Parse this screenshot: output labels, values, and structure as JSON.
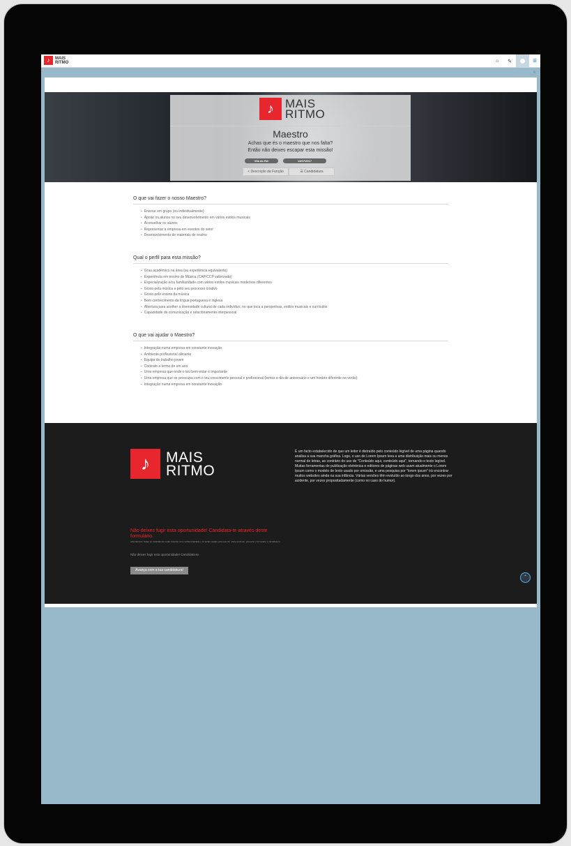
{
  "nav": {
    "logo_line1": "MAIS",
    "logo_line2": "RITMO",
    "logo_glyph": "♪",
    "home_icon": "⌂",
    "edit_icon": "✎",
    "menu_icon": "≡"
  },
  "hero": {
    "logo_line1": "MAIS",
    "logo_line2": "RITMO",
    "logo_glyph": "♪",
    "title": "Maestro",
    "subtitle1": "Achas que és o maestro que nos falta?",
    "subtitle2": "Então não deixes escapar esta missão!",
    "location": "Vila do Rei",
    "date": "14/07/2017",
    "btn_description": "< Descrição da Função",
    "btn_apply": "☰ Candidatura"
  },
  "sections": [
    {
      "title": "O que vai fazer o nosso Maestro?",
      "items": [
        "Ensinar em grupo (ou individualmente)",
        "Apoiar os alunos no seu desenvolvimento em vários estilos musicais",
        "Aconselhar os alunos",
        "Representar a empresa em eventos do setor",
        "Desenvolvimento de materiais de ensino"
      ]
    },
    {
      "title": "Qual o perfil para esta missão?",
      "items": [
        "Grau académico na área (ou experiência equivalente)",
        "Experiência em ensino de Música (CAP/CCP valorizado)",
        "Especialização e/ou familiaridade com vários estilos musicais modernos diferentes",
        "Gosto pela música e pelo seu processo criativo",
        "Gosto pelo ensino da música",
        "Bom conhecimento da língua portuguesa e inglesa",
        "Abertura para acolher a diversidade cultural de cada indivíduo, no que toca a perspetivas, estilos musicais e currículos",
        "Capacidade de comunicação e relacionamento interpessoal"
      ]
    },
    {
      "title": "O que vai ajudar o Maestro?",
      "items": [
        "Integração numa empresa em constante inovação",
        "Ambiente profissional aliciante",
        "Equipa de trabalho jovem",
        "Contrato a termo de um ano",
        "Uma empresa que onde o teu bem-estar é importante",
        "Uma empresa que se preocupa com o teu crescimento pessoal e profissional (temos o dia de aniversário e um horário diferente no verão)",
        "Integração numa empresa em constante inovação"
      ]
    }
  ],
  "footer": {
    "logo_line1": "MAIS",
    "logo_line2": "RITMO",
    "logo_glyph": "♪",
    "lorem": "É um facto estabelecido de que um leitor é distraído pelo conteúdo legível de uma página quando analisa a sua mancha gráfica. Logo, o uso de Lorem Ipsum leva a uma distribuição mais ou menos normal de letras, ao contrário do uso de \"Conteúdo aqui, conteúdo aqui\", tornando-o texto legível. Muitas ferramentas de publicação eletrónica e editores de páginas web usam atualmente o Lorem Ipsum como o modelo de texto usado por omissão, e uma pesquisa por \"lorem ipsum\" irá encontrar muitos websites ainda na sua infância. Várias versões têm evoluído ao longo dos anos, por vezes por acidente, por vezes propositadamente (como no caso do humor).",
    "cta": "Não deixes fugir esta oportunidade! Candidata-te através deste formulário.",
    "small_text": "Advertências: Todas as candidaturas serão tratadas com confidencialidade e só serão usadas para este fim. Para continuar, preenche o formulário e candidata-te.",
    "link_text": "Não deixes fugir esta oportunidade! Candidata-te.",
    "button": "Avança com a tua candidatura!",
    "scroll_top_icon": "⌃"
  }
}
